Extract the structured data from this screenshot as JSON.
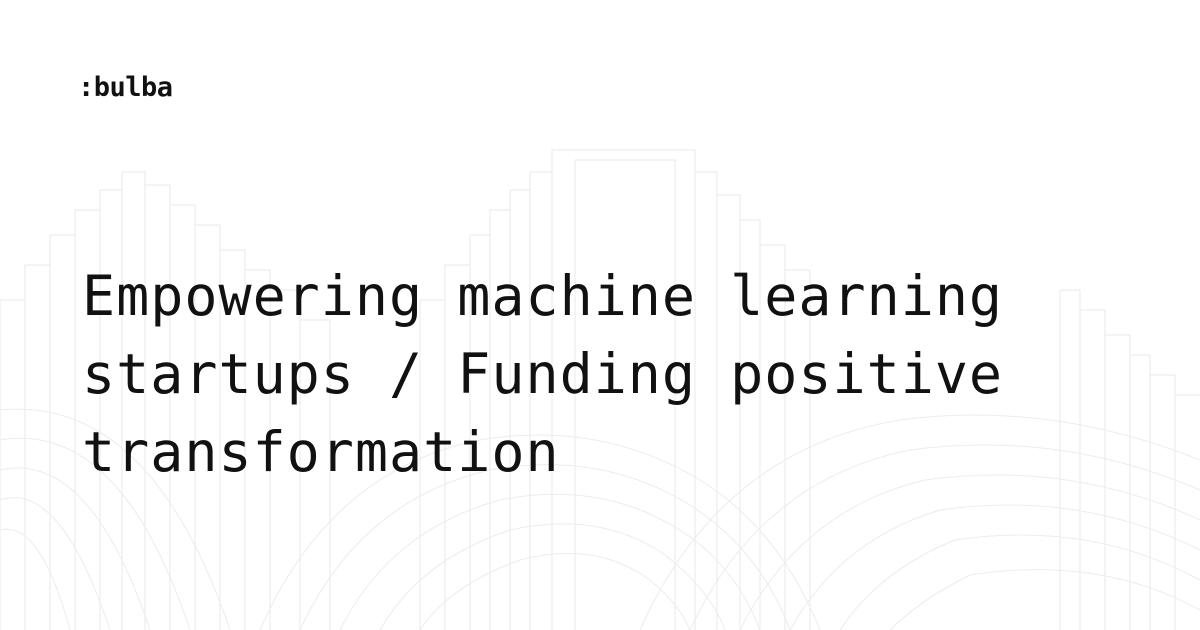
{
  "brand": {
    "logo_text": ":bulba"
  },
  "headline": {
    "lines": [
      "Empowering machine learning",
      "startups / Funding positive",
      "transformation"
    ]
  },
  "colors": {
    "background": "#ffffff",
    "text": "#111111",
    "pattern": "#e6e6e6"
  }
}
